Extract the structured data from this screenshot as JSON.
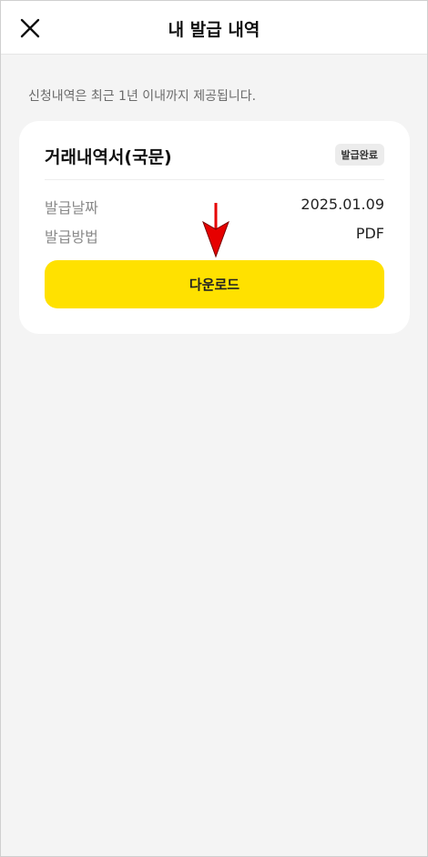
{
  "header": {
    "title": "내 발급 내역",
    "close_icon": "close-icon"
  },
  "notice": "신청내역은 최근 1년 이내까지 제공됩니다.",
  "card": {
    "title": "거래내역서(국문)",
    "badge": "발급완료",
    "rows": [
      {
        "label": "발급날짜",
        "value": "2025.01.09"
      },
      {
        "label": "발급방법",
        "value": "PDF"
      }
    ],
    "download_label": "다운로드"
  },
  "colors": {
    "accent": "#ffe100",
    "arrow": "#e60000"
  }
}
